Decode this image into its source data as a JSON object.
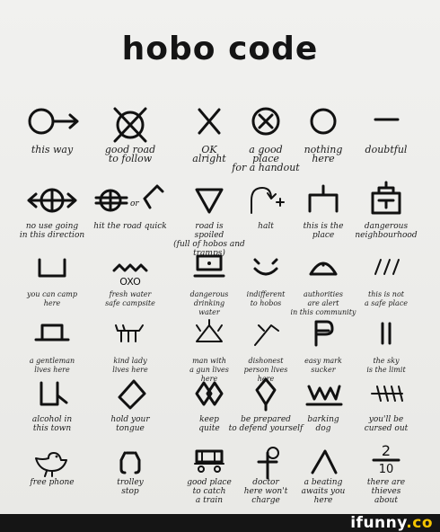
{
  "title": "hobo code",
  "footer": {
    "brand_main": "ifunny",
    "brand_dot": ".co"
  },
  "symbols": [
    {
      "icon": "circle-arrow-icon",
      "label": "this way"
    },
    {
      "icon": "crossed-circle-icon",
      "label": "good road\nto follow"
    },
    {
      "icon": "x-mark-icon",
      "label": "OK\nalright"
    },
    {
      "icon": "circled-x-icon",
      "label": "a good\nplace\nfor a handout"
    },
    {
      "icon": "empty-circle-icon",
      "label": "nothing\nhere"
    },
    {
      "icon": "dash-icon",
      "label": "doubtful"
    },
    {
      "icon": "barred-circle-icon",
      "label": "no use going\nin this direction"
    },
    {
      "icon": "hit-the-road-icon",
      "label": "hit the road quick"
    },
    {
      "icon": "triangle-icon",
      "label": "road is\nspoiled\n(full of hobos and tramps)"
    },
    {
      "icon": "halt-icon",
      "label": "halt"
    },
    {
      "icon": "place-icon",
      "label": "this is the\nplace"
    },
    {
      "icon": "dangerous-house-icon",
      "label": "dangerous\nneighbourhood"
    },
    {
      "icon": "campsite-icon",
      "label": "you can camp\nhere"
    },
    {
      "icon": "fresh-water-icon",
      "label": "fresh water\nsafe campsite"
    },
    {
      "icon": "drinking-water-icon",
      "label": "dangerous\ndrinking\nwater"
    },
    {
      "icon": "indifferent-icon",
      "label": "indifferent\nto hobos"
    },
    {
      "icon": "authorities-icon",
      "label": "authorities\nare alert\nin this community"
    },
    {
      "icon": "not-safe-icon",
      "label": "this is not\na safe place"
    },
    {
      "icon": "gentleman-icon",
      "label": "a gentleman\nlives here"
    },
    {
      "icon": "kind-lady-icon",
      "label": "kind lady\nlives here"
    },
    {
      "icon": "man-with-gun-icon",
      "label": "man with\na gun lives\nhere"
    },
    {
      "icon": "dishonest-icon",
      "label": "dishonest\nperson lives\nhere"
    },
    {
      "icon": "easy-mark-icon",
      "label": "easy mark\nsucker"
    },
    {
      "icon": "sky-limit-icon",
      "label": "the sky\nis the limit"
    },
    {
      "icon": "alcohol-icon",
      "label": "alcohol in\nthis town"
    },
    {
      "icon": "hold-tongue-icon",
      "label": "hold your\ntongue"
    },
    {
      "icon": "keep-quite-icon",
      "label": "keep\nquite"
    },
    {
      "icon": "be-prepared-icon",
      "label": "be prepared\nto defend yourself"
    },
    {
      "icon": "barking-dog-icon",
      "label": "barking\ndog"
    },
    {
      "icon": "cursed-out-icon",
      "label": "you'll be\ncursed out"
    },
    {
      "icon": "free-phone-icon",
      "label": "free phone"
    },
    {
      "icon": "trolley-stop-icon",
      "label": "trolley\nstop"
    },
    {
      "icon": "catch-train-icon",
      "label": "good place\nto catch\na train"
    },
    {
      "icon": "doctor-icon",
      "label": "doctor\nhere won't\ncharge"
    },
    {
      "icon": "beating-icon",
      "label": "a beating\nawaits you\nhere"
    },
    {
      "icon": "thieves-icon",
      "label": "there are\nthieves\nabout"
    }
  ]
}
